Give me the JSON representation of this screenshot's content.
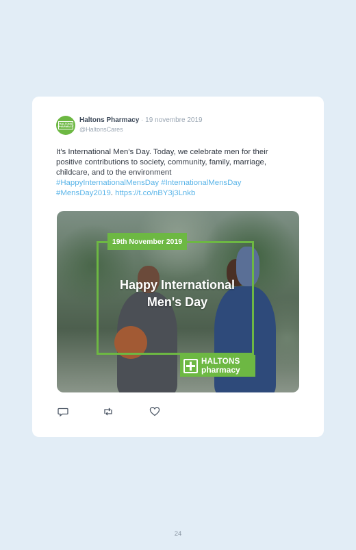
{
  "tweet": {
    "author_name": "Haltons Pharmacy",
    "separator": "·",
    "date": "19 novembre 2019",
    "handle": "@HaltonsCares",
    "avatar_text": "HALTONS PHARMACY",
    "text_plain": "It's International Men's Day. Today, we celebrate men for their positive contributions to society, community, family, marriage, childcare, and to the environment",
    "hashtag_1": "#HappyInternationalMensDay",
    "hashtag_2": "#InternationalMensDay",
    "hashtag_3": "#MensDay2019",
    "link": "https://t.co/nBY3j3Lnkb"
  },
  "media": {
    "date_tag": "19th November 2019",
    "headline": "Happy International Men's Day",
    "logo_line1": "HALTONS",
    "logo_line2": "pharmacy",
    "accent_color": "#6db843"
  },
  "actions": {
    "reply_icon": "reply-icon",
    "retweet_icon": "retweet-icon",
    "like_icon": "heart-icon"
  },
  "page": {
    "number": "24"
  }
}
